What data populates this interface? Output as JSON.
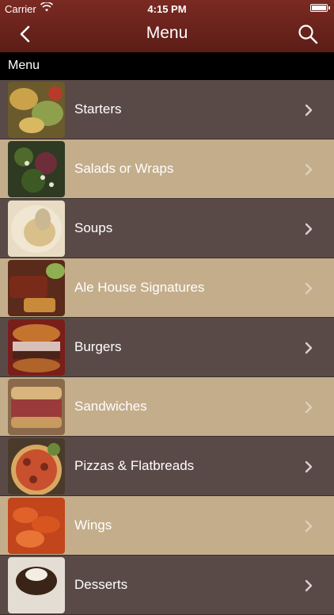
{
  "status_bar": {
    "carrier": "Carrier",
    "time": "4:15 PM"
  },
  "navbar": {
    "title": "Menu"
  },
  "section": {
    "title": "Menu"
  },
  "menu_items": [
    {
      "label": "Starters"
    },
    {
      "label": "Salads or Wraps"
    },
    {
      "label": "Soups"
    },
    {
      "label": "Ale House Signatures"
    },
    {
      "label": "Burgers"
    },
    {
      "label": "Sandwiches"
    },
    {
      "label": "Pizzas & Flatbreads"
    },
    {
      "label": "Wings"
    },
    {
      "label": "Desserts"
    }
  ],
  "colors": {
    "navbar": "#6d241d",
    "row_dark": "#5a4a47",
    "row_light": "#c4ad8b"
  }
}
